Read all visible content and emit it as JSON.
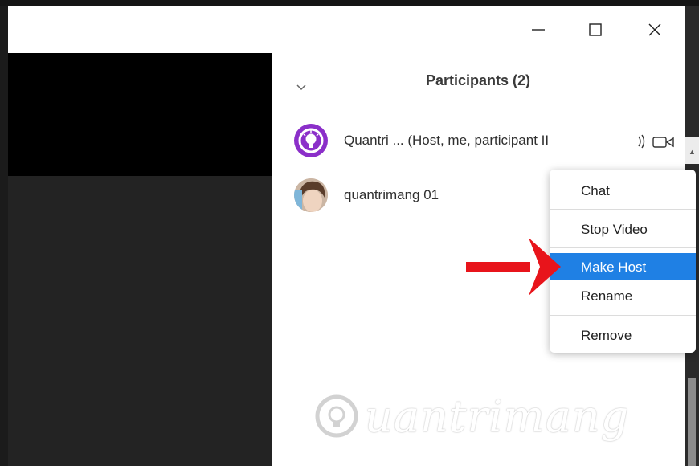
{
  "window": {
    "controls": {
      "minimize_icon": "minimize-icon",
      "maximize_icon": "maximize-icon",
      "close_icon": "close-icon"
    }
  },
  "participants_panel": {
    "title": "Participants (2)",
    "collapse_icon": "chevron-down-icon",
    "participants": [
      {
        "name": "Quantri ... (Host, me, participant II",
        "avatar": "lightbulb-logo",
        "mic_icon": "microphone-icon",
        "video_icon": "video-camera-icon"
      },
      {
        "name": "quantrimang 01",
        "avatar": "photo-avatar"
      }
    ]
  },
  "context_menu": {
    "items": [
      {
        "label": "Chat"
      },
      {
        "label": "Stop Video"
      },
      {
        "label": "Make Host",
        "highlighted": true
      },
      {
        "label": "Rename"
      },
      {
        "label": "Remove"
      }
    ]
  },
  "annotation": {
    "arrow_color": "#e8141b",
    "points_to": "Make Host"
  },
  "watermark": {
    "text": "uantrimang",
    "icon": "lightbulb-icon"
  },
  "colors": {
    "highlight": "#1f80e4",
    "avatar_purple": "#8b2fc9"
  }
}
